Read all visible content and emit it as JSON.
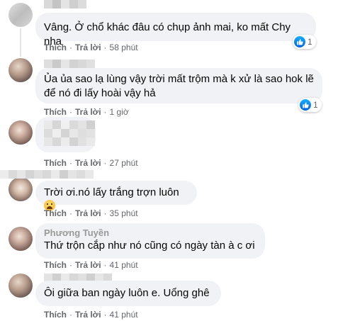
{
  "comments": [
    {
      "author": "",
      "text": "Vâng. Ở chổ khác đâu có chụp ảnh mai, ko mất Chy nha",
      "like": "Thích",
      "reply": "Trả lời",
      "time": "58 phút",
      "reaction_count": "1"
    },
    {
      "author": "",
      "text": "Ủa ủa sao lạ lùng vậy trời mất trộm mà k xử là sao hok lẽ để nó đi lấy hoài vậy hả",
      "like": "Thích",
      "reply": "Trả lời",
      "time": "1 giờ",
      "reaction_count": "1"
    },
    {
      "author": "",
      "text": "",
      "like": "Thích",
      "reply": "Trả lời",
      "time": "27 phút"
    },
    {
      "author": "",
      "text": "Trời ơi.nó lấy trắng trợn luôn",
      "like": "Thích",
      "reply": "Trả lời",
      "time": "35 phút"
    },
    {
      "author": "Phương Tuyền",
      "text": "Thứ trộn cắp như nó cũng có ngày tàn à c ơi",
      "like": "Thích",
      "reply": "Trả lời",
      "time": "41 phút"
    },
    {
      "author": "",
      "text": "Ôi giữa ban ngày luôn e. Uổng ghê",
      "like": "Thích",
      "reply": "Trả lời",
      "time": "41 phút"
    }
  ],
  "icons": {
    "like": "like-icon",
    "emoji": "anxious-sweat-emoji"
  },
  "colors": {
    "bubble": "#f0f2f5",
    "meta": "#65676b",
    "like_blue": "#1877f2"
  }
}
